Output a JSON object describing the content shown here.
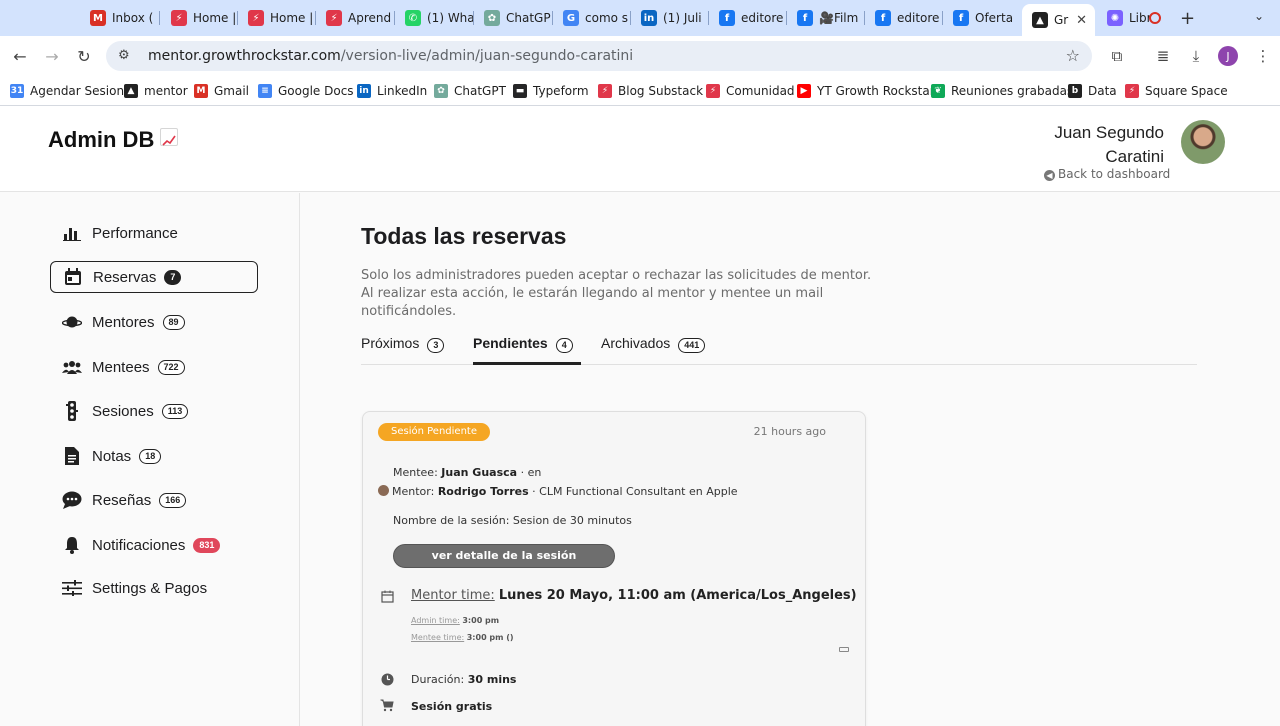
{
  "browser": {
    "tabs": [
      {
        "title": "Inbox (",
        "icon": "gmail-icon",
        "color": "#d93025",
        "glyph": "M"
      },
      {
        "title": "Home |",
        "icon": "growth-rockstar-icon",
        "color": "#e0374a",
        "glyph": "⚡"
      },
      {
        "title": "Home |",
        "icon": "growth-rockstar-icon",
        "color": "#e0374a",
        "glyph": "⚡"
      },
      {
        "title": "Aprend",
        "icon": "growth-rockstar-icon",
        "color": "#e0374a",
        "glyph": "⚡"
      },
      {
        "title": "(1) Wha",
        "icon": "whatsapp-icon",
        "color": "#25d366",
        "glyph": "✆"
      },
      {
        "title": "ChatGP",
        "icon": "chatgpt-icon",
        "color": "#74aa9c",
        "glyph": "✿"
      },
      {
        "title": "como s",
        "icon": "google-icon",
        "color": "#4285f4",
        "glyph": "G"
      },
      {
        "title": "(1) Juli",
        "icon": "linkedin-icon",
        "color": "#0a66c2",
        "glyph": "in"
      },
      {
        "title": "editore",
        "icon": "facebook-icon",
        "color": "#1877f2",
        "glyph": "f"
      },
      {
        "title": "🎥Film",
        "icon": "facebook-icon",
        "color": "#1877f2",
        "glyph": "f"
      },
      {
        "title": "editore",
        "icon": "facebook-icon",
        "color": "#1877f2",
        "glyph": "f"
      },
      {
        "title": "Oferta",
        "icon": "facebook-icon",
        "color": "#1877f2",
        "glyph": "f"
      },
      {
        "title": "Gr",
        "icon": "mentor-app-icon",
        "color": "#222222",
        "glyph": "▲"
      },
      {
        "title": "Libr",
        "icon": "libr-icon",
        "color": "#7b61ff",
        "glyph": "✺"
      }
    ],
    "url_host": "mentor.growthrockstar.com",
    "url_path": "/version-live/admin/juan-segundo-caratini",
    "profile_initial": "J",
    "bookmarks": [
      {
        "label": "Agendar Sesion",
        "icon": "calendar-icon",
        "color": "#4285f4",
        "glyph": "31"
      },
      {
        "label": "mentor",
        "icon": "mentor-icon",
        "color": "#222222",
        "glyph": "▲"
      },
      {
        "label": "Gmail",
        "icon": "gmail-icon",
        "color": "#d93025",
        "glyph": "M"
      },
      {
        "label": "Google Docs",
        "icon": "docs-icon",
        "color": "#4285f4",
        "glyph": "≡"
      },
      {
        "label": "LinkedIn",
        "icon": "linkedin-icon",
        "color": "#0a66c2",
        "glyph": "in"
      },
      {
        "label": "ChatGPT",
        "icon": "chatgpt-icon",
        "color": "#74aa9c",
        "glyph": "✿"
      },
      {
        "label": "Typeform",
        "icon": "typeform-icon",
        "color": "#262627",
        "glyph": "▬"
      },
      {
        "label": "Blog Substack",
        "icon": "growth-rockstar-icon",
        "color": "#e0374a",
        "glyph": "⚡"
      },
      {
        "label": "Comunidad",
        "icon": "growth-rockstar-icon",
        "color": "#e0374a",
        "glyph": "⚡"
      },
      {
        "label": "YT Growth Rockstar",
        "icon": "youtube-icon",
        "color": "#ff0000",
        "glyph": "▶"
      },
      {
        "label": "Reuniones grabadas",
        "icon": "leaf-icon",
        "color": "#0fa958",
        "glyph": "❦"
      },
      {
        "label": "Data",
        "icon": "data-icon",
        "color": "#222222",
        "glyph": "b"
      },
      {
        "label": "Square Space",
        "icon": "growth-rockstar-icon",
        "color": "#e0374a",
        "glyph": "⚡"
      }
    ]
  },
  "header": {
    "title": "Admin DB",
    "user_name": "Juan Segundo Caratini",
    "back_label": "Back to dashboard"
  },
  "sidebar": {
    "items": [
      {
        "label": "Performance",
        "icon": "bar-chart-icon",
        "count": null,
        "active": false
      },
      {
        "label": "Reservas",
        "icon": "calendar-icon",
        "count": "7",
        "active": true
      },
      {
        "label": "Mentores",
        "icon": "planet-icon",
        "count": "89",
        "active": false
      },
      {
        "label": "Mentees",
        "icon": "users-icon",
        "count": "722",
        "active": false
      },
      {
        "label": "Sesiones",
        "icon": "traffic-light-icon",
        "count": "113",
        "active": false
      },
      {
        "label": "Notas",
        "icon": "document-icon",
        "count": "18",
        "active": false
      },
      {
        "label": "Reseñas",
        "icon": "comment-icon",
        "count": "166",
        "active": false
      },
      {
        "label": "Notificaciones",
        "icon": "bell-icon",
        "count": "831",
        "active": false
      },
      {
        "label": "Settings & Pagos",
        "icon": "sliders-icon",
        "count": null,
        "active": false
      }
    ]
  },
  "main": {
    "title": "Todas las reservas",
    "description": "Solo los administradores pueden aceptar o rechazar las solicitudes de mentor. Al realizar esta acción, le estarán llegando al mentor y mentee un mail notificándoles.",
    "tabs": [
      {
        "label": "Próximos",
        "count": "3",
        "active": false
      },
      {
        "label": "Pendientes",
        "count": "4",
        "active": true
      },
      {
        "label": "Archivados",
        "count": "441",
        "active": false
      }
    ]
  },
  "card": {
    "status": "Sesión Pendiente",
    "status_color": "#f5a623",
    "time_ago": "21 hours ago",
    "mentee_label": "Mentee:",
    "mentee_name": "Juan Guasca",
    "mentee_suffix": "·  en",
    "mentor_label": "Mentor:",
    "mentor_name": "Rodrigo Torres",
    "mentor_role": "· CLM Functional Consultant en Apple",
    "session_name": "Nombre de la sesión: Sesion de 30 minutos",
    "detail_button": "ver detalle de la sesión",
    "mentor_time_label": "Mentor time:",
    "mentor_time_value": "Lunes 20 Mayo, 11:00 am (America/Los_Angeles)",
    "admin_time_label": "Admin time:",
    "admin_time_value": "3:00 pm",
    "mentee_time_label": "Mentee time:",
    "mentee_time_value": "3:00 pm ()",
    "duration_label": "Duración:",
    "duration_value": "30 mins",
    "price": "Sesión gratis"
  }
}
